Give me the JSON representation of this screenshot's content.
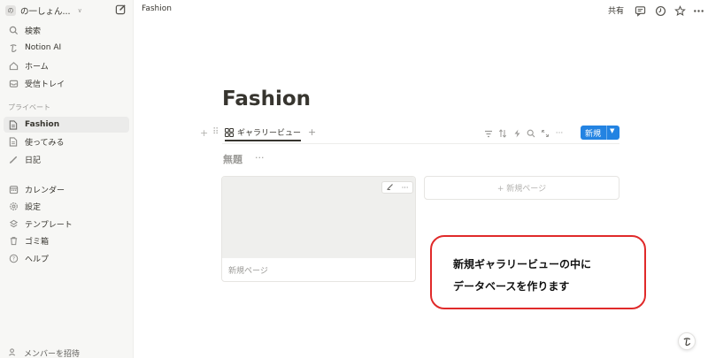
{
  "sidebar": {
    "workspace": {
      "avatar": "の",
      "name": "の一しょん...",
      "chevron": "∨"
    },
    "top_items": [
      {
        "label": "検索",
        "icon": "search-icon"
      },
      {
        "label": "Notion AI",
        "icon": "notion-ai-icon"
      },
      {
        "label": "ホーム",
        "icon": "home-icon"
      },
      {
        "label": "受信トレイ",
        "icon": "inbox-icon"
      }
    ],
    "section_label": "プライベート",
    "private_items": [
      {
        "label": "Fashion",
        "icon": "page-icon",
        "active": true
      },
      {
        "label": "使ってみる",
        "icon": "page-icon"
      },
      {
        "label": "日記",
        "icon": "pencil-icon"
      }
    ],
    "bottom_items": [
      {
        "label": "カレンダー",
        "icon": "calendar-icon"
      },
      {
        "label": "設定",
        "icon": "gear-icon"
      },
      {
        "label": "テンプレート",
        "icon": "template-icon"
      },
      {
        "label": "ゴミ箱",
        "icon": "trash-icon"
      },
      {
        "label": "ヘルプ",
        "icon": "help-icon"
      }
    ],
    "invite_label": "メンバーを招待"
  },
  "topbar": {
    "breadcrumb": "Fashion",
    "share_label": "共有",
    "icons": [
      "comment-icon",
      "clock-icon",
      "star-icon",
      "more-icon"
    ]
  },
  "page": {
    "title": "Fashion",
    "view_tab": "ギャラリービュー",
    "new_button": "新規",
    "database_title": "無題",
    "more": "···",
    "card": {
      "title": "新規ページ"
    },
    "new_page_card": "+ 新規ページ"
  },
  "callout": {
    "line1": "新規ギャラリービューの中に",
    "line2": "データベースを作ります"
  },
  "colors": {
    "accent": "#2383e2",
    "callout_border": "#e02a2a",
    "sidebar_bg": "#f7f7f5"
  }
}
